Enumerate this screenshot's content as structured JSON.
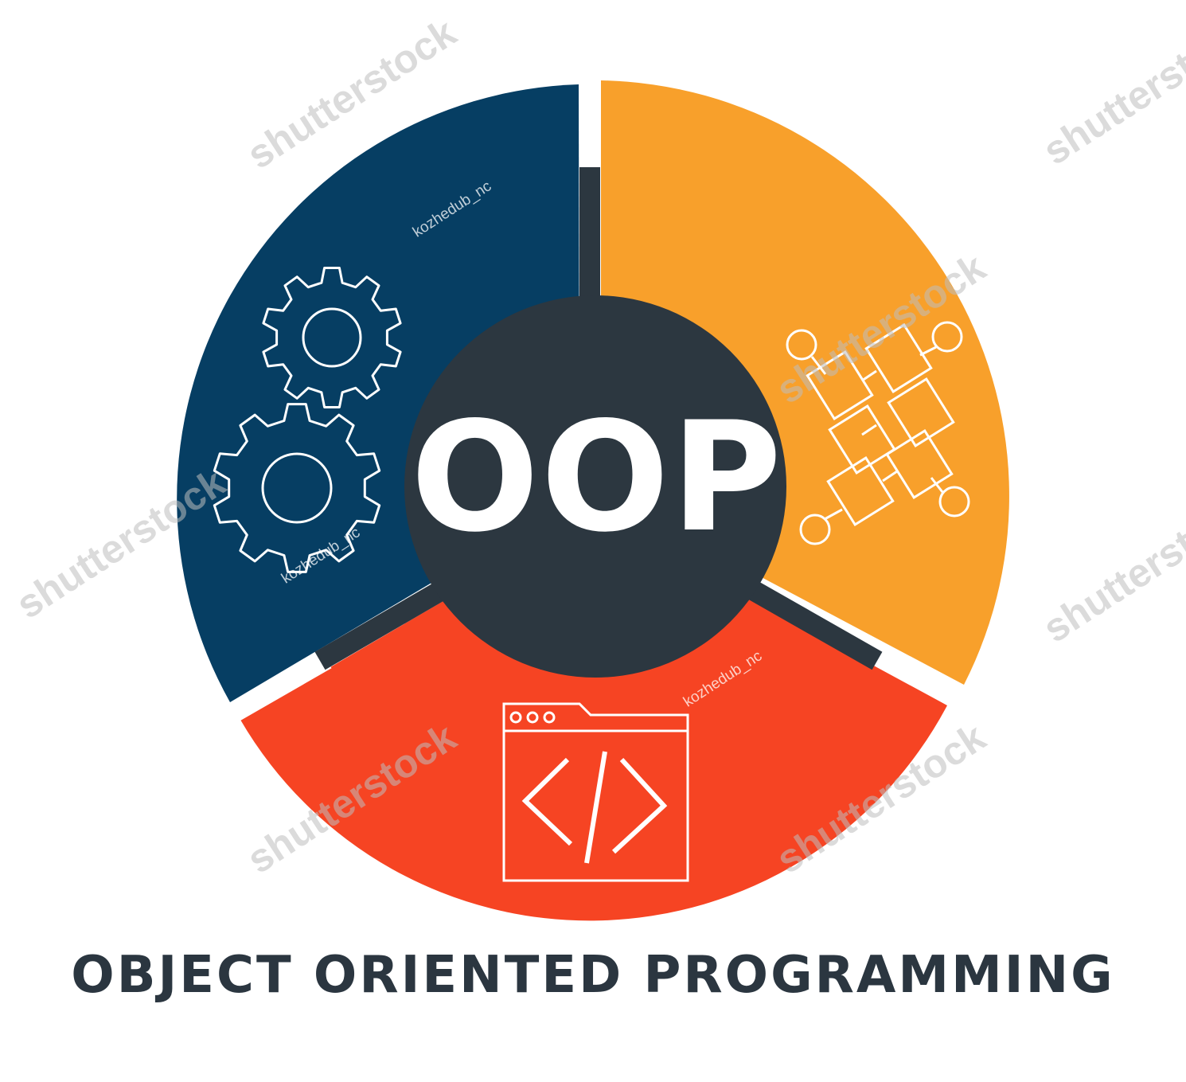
{
  "diagram": {
    "center_label": "OOP",
    "caption": "OBJECT ORIENTED PROGRAMMING",
    "segments": [
      {
        "name": "blue-segment",
        "color": "#063e63",
        "icon": "gears-icon"
      },
      {
        "name": "orange-segment",
        "color": "#f8a02b",
        "icon": "linked-blocks-icon"
      },
      {
        "name": "red-segment",
        "color": "#f64423",
        "icon": "code-window-icon"
      }
    ],
    "hub_color": "#2c3740",
    "caption_color": "#2b3640"
  },
  "watermarks": {
    "stock": "shutterstock",
    "author": "kozhedub_nc"
  }
}
